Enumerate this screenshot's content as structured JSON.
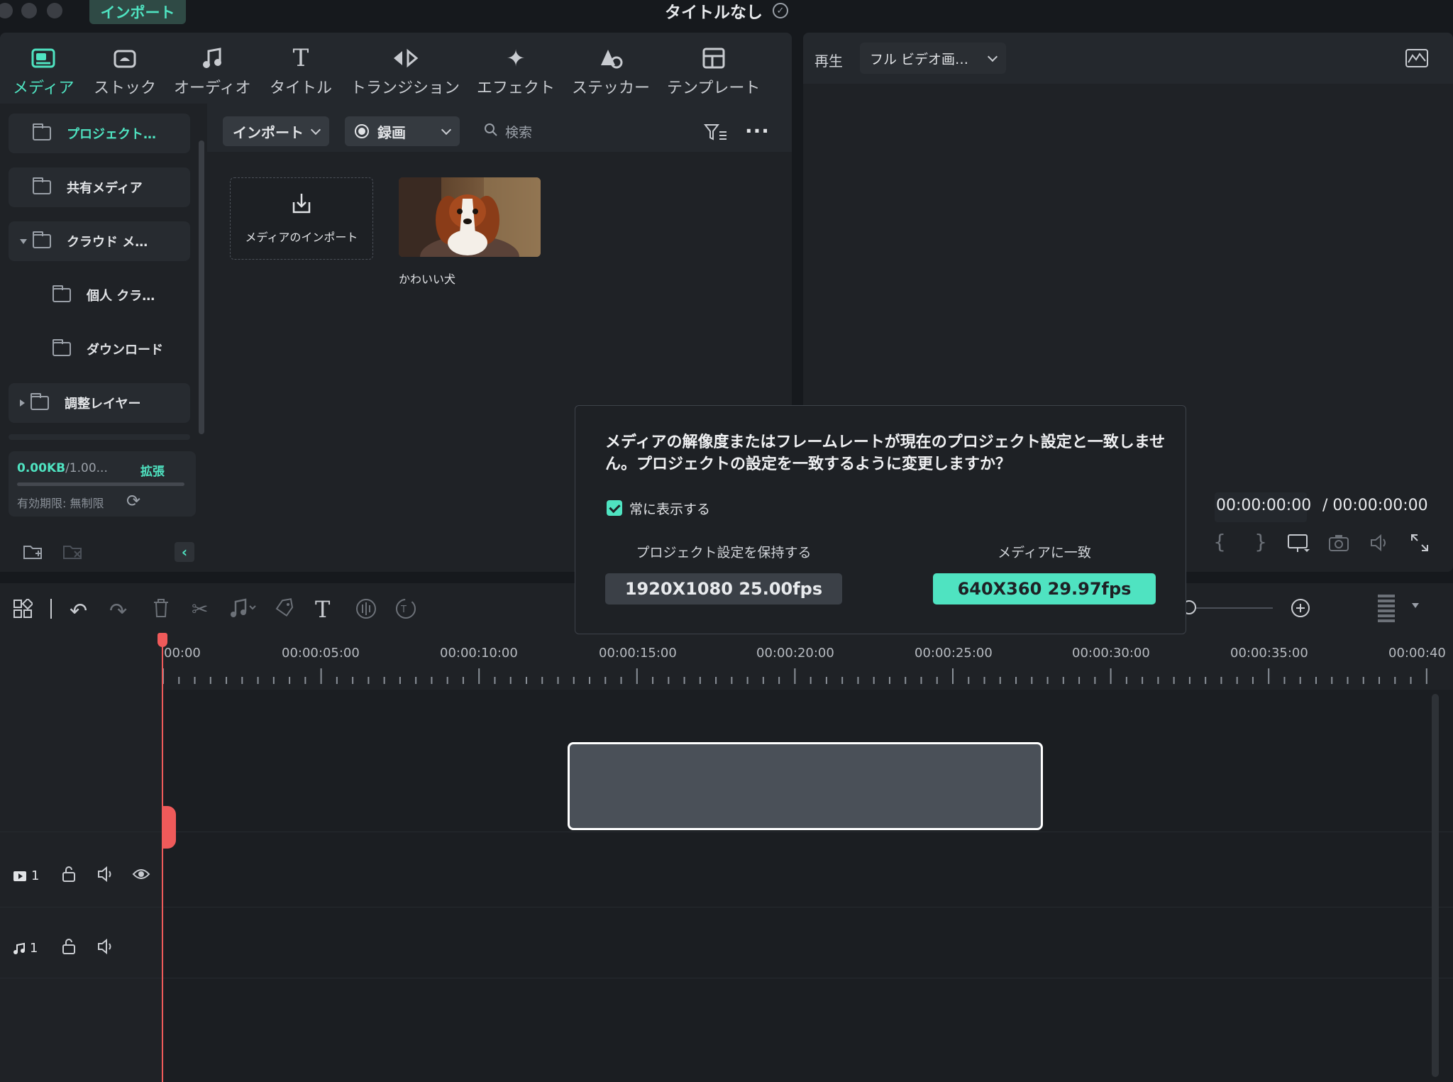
{
  "window": {
    "import_tab": "インポート",
    "title": "タイトルなし"
  },
  "tabs": [
    {
      "label": "メディア"
    },
    {
      "label": "ストック"
    },
    {
      "label": "オーディオ"
    },
    {
      "label": "タイトル"
    },
    {
      "label": "トランジション"
    },
    {
      "label": "エフェクト"
    },
    {
      "label": "ステッカー"
    },
    {
      "label": "テンプレート"
    }
  ],
  "sidebar": {
    "items": [
      {
        "label": "プロジェクト…"
      },
      {
        "label": "共有メディア"
      },
      {
        "label": "クラウド メ…"
      },
      {
        "label": "個人 クラ…"
      },
      {
        "label": "ダウンロード"
      },
      {
        "label": "調整レイヤー"
      }
    ],
    "storage": {
      "used": "0.00KB",
      "total": "/1.00...",
      "expand": "拡張",
      "expiry": "有効期限: 無制限",
      "usage_fraction": 0.0
    }
  },
  "media_toolbar": {
    "import": "インポート",
    "record": "録画",
    "search_placeholder": "検索"
  },
  "media": {
    "import_label": "メディアのインポート",
    "clip_name": "かわいい犬"
  },
  "preview": {
    "play_label": "再生",
    "quality": "フル ビデオ画…",
    "time_current": "00:00:00:00",
    "time_total": "/ 00:00:00:00"
  },
  "timeline": {
    "ruler_labels": [
      "00:00",
      "00:00:05:00",
      "00:00:10:00",
      "00:00:15:00",
      "00:00:20:00",
      "00:00:25:00",
      "00:00:30:00",
      "00:00:35:00",
      "00:00:40"
    ],
    "video_track": "1",
    "audio_track": "1"
  },
  "dialog": {
    "message": "メディアの解像度またはフレームレートが現在のプロジェクト設定と一致しません。プロジェクトの設定を一致するように変更しますか？",
    "always_show": "常に表示する",
    "keep_label": "プロジェクト設定を保持する",
    "keep_value": "1920X1080  25.00fps",
    "match_label": "メディアに一致",
    "match_value": "640X360  29.97fps"
  },
  "colors": {
    "accent": "#4fe3c1",
    "playhead": "#ef5a5a"
  }
}
